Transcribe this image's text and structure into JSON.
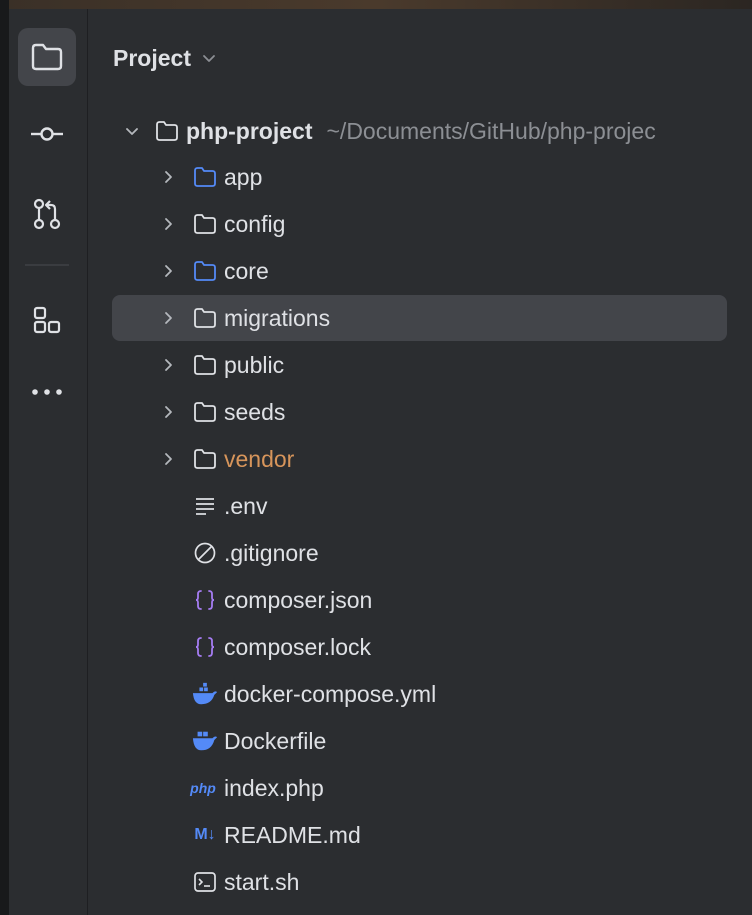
{
  "colors": {
    "background": "#2b2d30",
    "rail_active": "#43454a",
    "selection": "#43454a",
    "text": "#dfe1e5",
    "muted": "#8c8f94",
    "source_folder": "#548af7",
    "excluded_folder": "#d7955b",
    "json_icon": "#a57cf2",
    "docker_icon": "#548af7"
  },
  "rail": {
    "items": [
      {
        "name": "project",
        "icon": "folder-icon",
        "active": true
      },
      {
        "name": "commit",
        "icon": "commit-icon",
        "active": false
      },
      {
        "name": "pull-requests",
        "icon": "pull-request-icon",
        "active": false
      },
      {
        "name": "structure",
        "icon": "structure-icon",
        "active": false
      },
      {
        "name": "more",
        "icon": "more-icon",
        "active": false
      }
    ]
  },
  "panel": {
    "title": "Project",
    "dropdown_icon": "chevron-down-icon"
  },
  "tree": {
    "root": {
      "name": "php-project",
      "path": "~/Documents/GitHub/php-projec",
      "expanded": true
    },
    "items": [
      {
        "name": "app",
        "type": "folder",
        "icon": "source-folder-icon"
      },
      {
        "name": "config",
        "type": "folder",
        "icon": "folder-icon"
      },
      {
        "name": "core",
        "type": "folder",
        "icon": "source-folder-icon"
      },
      {
        "name": "migrations",
        "type": "folder",
        "icon": "folder-icon",
        "selected": true
      },
      {
        "name": "public",
        "type": "folder",
        "icon": "folder-icon"
      },
      {
        "name": "seeds",
        "type": "folder",
        "icon": "folder-icon"
      },
      {
        "name": "vendor",
        "type": "folder",
        "icon": "folder-icon",
        "excluded": true
      },
      {
        "name": ".env",
        "type": "file",
        "icon": "text-file-icon"
      },
      {
        "name": ".gitignore",
        "type": "file",
        "icon": "ignore-file-icon"
      },
      {
        "name": "composer.json",
        "type": "file",
        "icon": "json-icon"
      },
      {
        "name": "composer.lock",
        "type": "file",
        "icon": "json-icon"
      },
      {
        "name": "docker-compose.yml",
        "type": "file",
        "icon": "docker-compose-icon"
      },
      {
        "name": "Dockerfile",
        "type": "file",
        "icon": "docker-icon"
      },
      {
        "name": "index.php",
        "type": "file",
        "icon": "php-icon",
        "icon_text": "php"
      },
      {
        "name": "README.md",
        "type": "file",
        "icon": "markdown-icon",
        "icon_text": "M↓"
      },
      {
        "name": "start.sh",
        "type": "file",
        "icon": "shell-script-icon"
      }
    ]
  }
}
